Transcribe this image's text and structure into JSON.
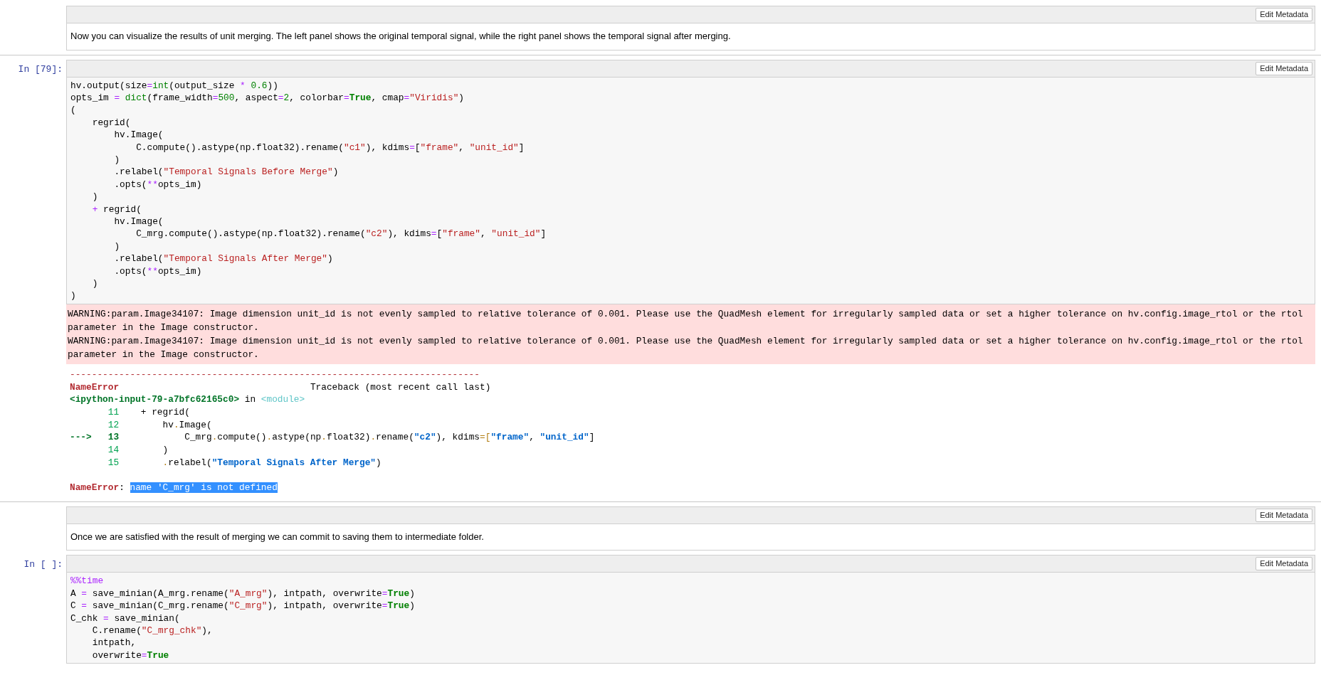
{
  "cells": [
    {
      "kind": "markdown",
      "rule_below": true,
      "button": "Edit Metadata",
      "text": "Now you can visualize the results of unit merging. The left panel shows the original temporal signal, while the right panel shows the temporal signal after merging."
    },
    {
      "kind": "code",
      "rule_below": true,
      "prompt": "In [79]:",
      "button": "Edit Metadata",
      "source": [
        "hv.output(size=int(output_size * 0.6))",
        "opts_im = dict(frame_width=500, aspect=2, colorbar=True, cmap=\"Viridis\")",
        "(",
        "    regrid(",
        "        hv.Image(",
        "            C.compute().astype(np.float32).rename(\"c1\"), kdims=[\"frame\", \"unit_id\"]",
        "        )",
        "        .relabel(\"Temporal Signals Before Merge\")",
        "        .opts(**opts_im)",
        "    )",
        "    + regrid(",
        "        hv.Image(",
        "            C_mrg.compute().astype(np.float32).rename(\"c2\"), kdims=[\"frame\", \"unit_id\"]",
        "        )",
        "        .relabel(\"Temporal Signals After Merge\")",
        "        .opts(**opts_im)",
        "    )",
        ")"
      ],
      "outputs": [
        {
          "kind": "stderr",
          "lines": [
            "WARNING:param.Image34107: Image dimension unit_id is not evenly sampled to relative tolerance of 0.001. Please use the QuadMesh element for irregularly sampled data or set a higher tolerance on hv.config.image_rtol or the rtol parameter in the Image constructor.",
            "WARNING:param.Image34107: Image dimension unit_id is not evenly sampled to relative tolerance of 0.001. Please use the QuadMesh element for irregularly sampled data or set a higher tolerance on hv.config.image_rtol or the rtol parameter in the Image constructor."
          ]
        },
        {
          "kind": "traceback",
          "separator": "---------------------------------------------------------------------------",
          "error_name": "NameError",
          "header_trailer": "Traceback (most recent call last)",
          "location": {
            "file": "<ipython-input-79-a7bfc62165c0>",
            "word": "in",
            "scope": "<module>"
          },
          "frames": [
            {
              "lineno": "11",
              "code": "    + regrid(",
              "current": false
            },
            {
              "lineno": "12",
              "code": "        hv.Image(",
              "current": false
            },
            {
              "arrow": "--->",
              "lineno": "13",
              "code": "            C_mrg.compute().astype(np.float32).rename(\"c2\"), kdims=[\"frame\", \"unit_id\"]",
              "current": true
            },
            {
              "lineno": "14",
              "code": "        )",
              "current": false
            },
            {
              "lineno": "15",
              "code": "        .relabel(\"Temporal Signals After Merge\")",
              "current": false
            }
          ],
          "final": {
            "name": "NameError",
            "sep": ":",
            "message": "name 'C_mrg' is not defined",
            "selected": true
          }
        }
      ]
    },
    {
      "kind": "markdown",
      "rule_below": false,
      "button": "Edit Metadata",
      "text": "Once we are satisfied with the result of merging we can commit to saving them to intermediate folder."
    },
    {
      "kind": "code",
      "rule_below": false,
      "prompt": "In [ ]:",
      "button": "Edit Metadata",
      "source": [
        "%%time",
        "A = save_minian(A_mrg.rename(\"A_mrg\"), intpath, overwrite=True)",
        "C = save_minian(C_mrg.rename(\"C_mrg\"), intpath, overwrite=True)",
        "C_chk = save_minian(",
        "    C.rename(\"C_mrg_chk\"),",
        "    intpath,",
        "    overwrite=True"
      ]
    }
  ]
}
